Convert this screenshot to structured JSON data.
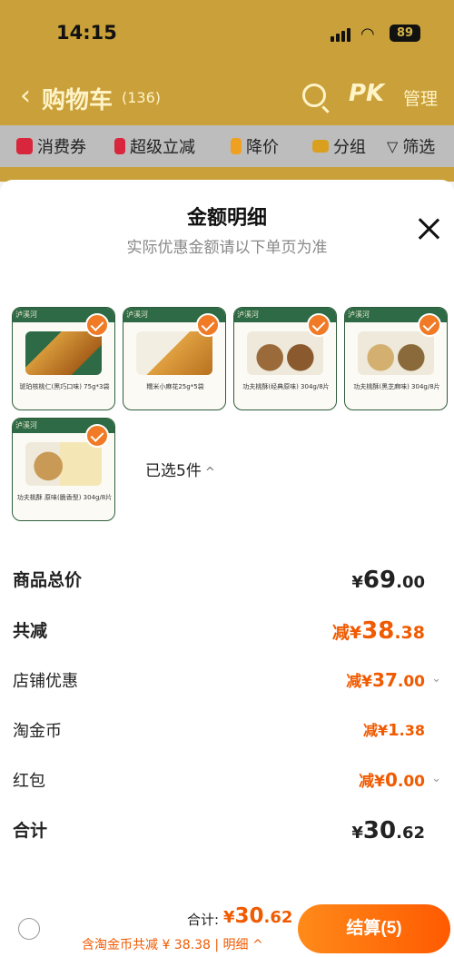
{
  "status_bar": {
    "time": "14:15",
    "battery": "89"
  },
  "header": {
    "title": "购物车",
    "count": "(136)",
    "pk": "PK",
    "manage": "管理"
  },
  "filters": [
    {
      "label": "消费券",
      "color": "#d8263c"
    },
    {
      "label": "超级立减",
      "color": "#d8263c"
    },
    {
      "label": "降价",
      "color": "#f0a020"
    },
    {
      "label": "分组",
      "color": "#d9a020"
    },
    {
      "label": "筛选",
      "color": "#333333"
    }
  ],
  "sheet": {
    "title": "金额明细",
    "subtitle": "实际优惠金额请以下单页为准",
    "items": [
      {
        "brand": "泸溪河",
        "caption": "琥珀核桃仁(黑巧口味)\n75g*3袋"
      },
      {
        "brand": "泸溪河",
        "caption": "糯米小麻花25g*5袋"
      },
      {
        "brand": "泸溪河",
        "caption": "功夫桃酥(经典原味)\n304g/8片"
      },
      {
        "brand": "泸溪河",
        "caption": "功夫桃酥(黑芝麻味)\n304g/8片"
      },
      {
        "brand": "泸溪河",
        "caption": "功夫桃酥 原味(脆香型)\n304g/8片"
      }
    ],
    "selected_label": "已选5件",
    "rows": {
      "total_price": {
        "label": "商品总价",
        "currency": "¥",
        "int": "69",
        "dec": ".00"
      },
      "total_discount": {
        "label": "共减",
        "prefix": "减¥",
        "int": "38",
        "dec": ".38"
      },
      "shop_discount": {
        "label": "店铺优惠",
        "prefix": "减¥",
        "int": "37",
        "dec": ".00"
      },
      "gold_coin": {
        "label": "淘金币",
        "prefix": "减¥",
        "int": "1",
        "dec": ".38"
      },
      "red_packet": {
        "label": "红包",
        "prefix": "减¥",
        "int": "0",
        "dec": ".00"
      },
      "sum": {
        "label": "合计",
        "currency": "¥",
        "int": "30",
        "dec": ".62"
      }
    }
  },
  "bottom_bar": {
    "total_label": "合计:",
    "total_currency": "¥",
    "total_int": "30",
    "total_dec": ".62",
    "discount_note": "含淘金币共减 ¥ 38.38 | 明细",
    "checkout": "结算(5)"
  },
  "colors": {
    "accent": "#f05a00",
    "brand_green": "#2d6a45",
    "check_orange": "#f07a26"
  }
}
